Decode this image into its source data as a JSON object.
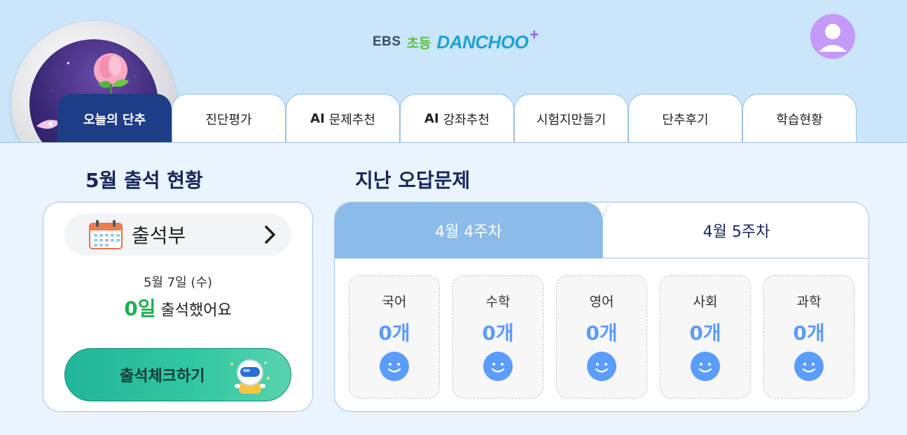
{
  "header": {
    "logo": {
      "ebs": "EBS",
      "grade": "초등",
      "brand": "DANCHOO",
      "plus": "+"
    },
    "tabs": [
      {
        "prefix": "",
        "label": "오늘의 단추",
        "active": true
      },
      {
        "prefix": "",
        "label": "진단평가",
        "active": false
      },
      {
        "prefix": "AI",
        "label": "문제추천",
        "active": false
      },
      {
        "prefix": "AI",
        "label": "강좌추천",
        "active": false
      },
      {
        "prefix": "",
        "label": "시험지만들기",
        "active": false
      },
      {
        "prefix": "",
        "label": "단추후기",
        "active": false
      },
      {
        "prefix": "",
        "label": "학습현황",
        "active": false
      }
    ]
  },
  "attendance": {
    "title": "5월 출석 현황",
    "book_label": "출석부",
    "date": "5월 7일 (수)",
    "days_count": "0일",
    "days_suffix": "출석했어요",
    "check_button": "출석체크하기"
  },
  "wrong_answers": {
    "title": "지난 오답문제",
    "week_tabs": [
      {
        "label": "4월 4주차",
        "active": true
      },
      {
        "label": "4월 5주차",
        "active": false
      }
    ],
    "subjects": [
      {
        "name": "국어",
        "count": "0개"
      },
      {
        "name": "수학",
        "count": "0개"
      },
      {
        "name": "영어",
        "count": "0개"
      },
      {
        "name": "사회",
        "count": "0개"
      },
      {
        "name": "과학",
        "count": "0개"
      }
    ]
  },
  "colors": {
    "header_bg": "#cbe5fb",
    "active_tab": "#1e3d87",
    "week_tab_active": "#8bbbe8",
    "count_blue": "#5b9cff",
    "attendance_green": "#1fae52"
  },
  "icons": {
    "calendar": "calendar-icon",
    "chevron": "chevron-right-icon",
    "profile": "user-avatar-icon",
    "face": "smile-face-icon",
    "robot": "astronaut-robot-icon"
  }
}
